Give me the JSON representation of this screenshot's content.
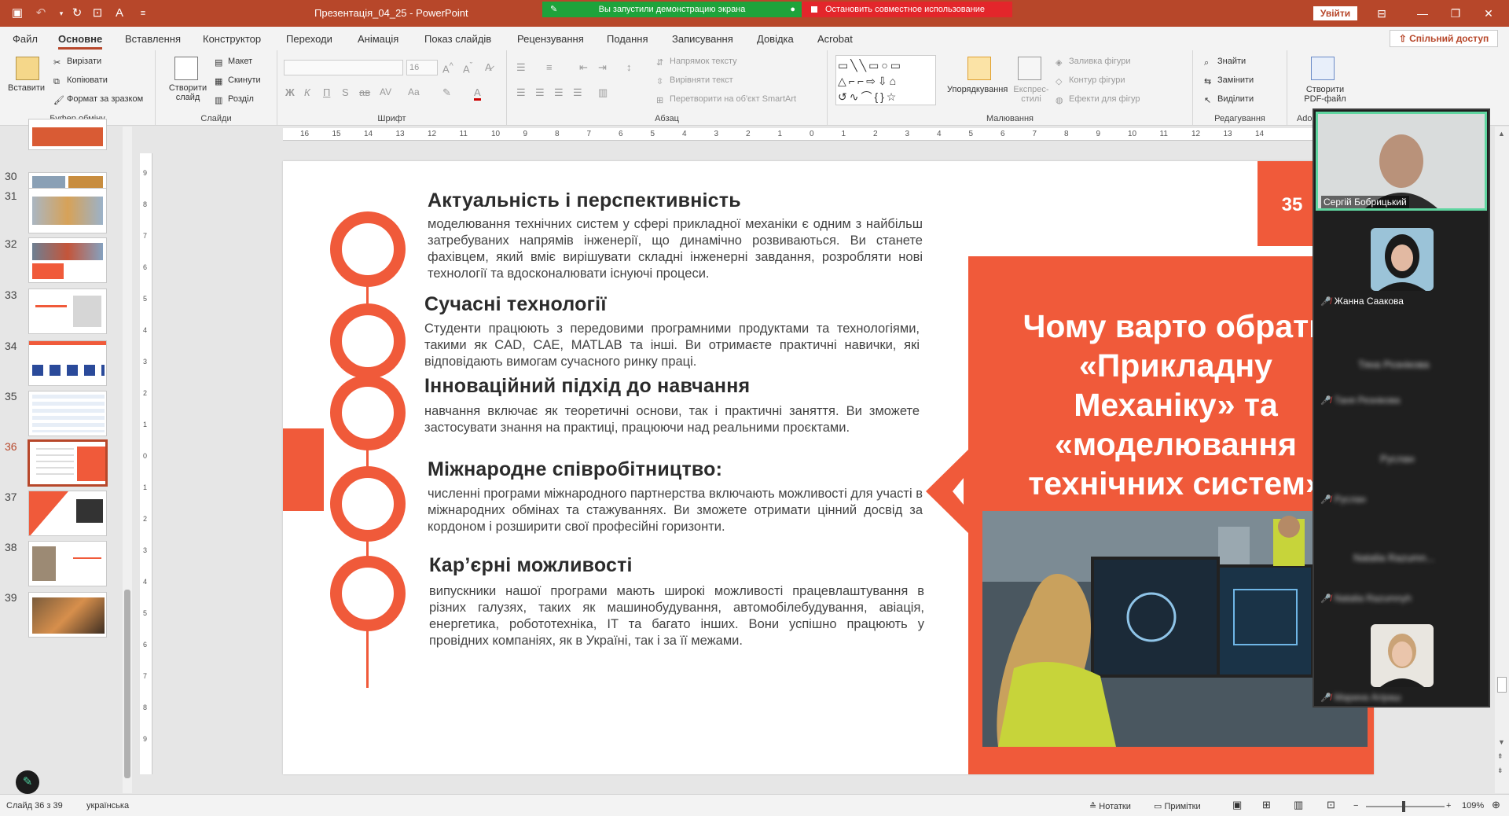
{
  "titlebar": {
    "document_title": "Презентація_04_25  -  PowerPoint",
    "screen_share_notice": "Вы запустили демонстрацию экрана",
    "stop_sharing": "Остановить совместное использование",
    "sign_in": "Увійти"
  },
  "ribbon_tabs": [
    "Файл",
    "Основне",
    "Вставлення",
    "Конструктор",
    "Переходи",
    "Анімація",
    "Показ слайдів",
    "Рецензування",
    "Подання",
    "Записування",
    "Довідка",
    "Acrobat"
  ],
  "share_button": "Спільний доступ",
  "ribbon": {
    "clipboard": {
      "paste": "Вставити",
      "cut": "Вирізати",
      "copy": "Копіювати",
      "format_painter": "Формат за зразком",
      "label": "Буфер обміну"
    },
    "slides": {
      "new_slide": "Створити слайд",
      "layout": "Макет",
      "reset": "Скинути",
      "section": "Розділ",
      "label": "Слайди"
    },
    "font": {
      "size": "16",
      "label": "Шрифт"
    },
    "paragraph": {
      "text_direction": "Напрямок тексту",
      "align_text": "Вирівняти текст",
      "convert_smartart": "Перетворити на об'єкт SmartArt",
      "label": "Абзац"
    },
    "drawing": {
      "arrange": "Упорядкування",
      "quick_styles": "Експрес-стилі",
      "shape_fill": "Заливка фігури",
      "shape_outline": "Контур фігури",
      "shape_effects": "Ефекти для фігур",
      "label": "Малювання"
    },
    "editing": {
      "find": "Знайти",
      "replace": "Замінити",
      "select": "Виділити",
      "label": "Редагування"
    },
    "adobe": {
      "create_pdf": "Створити PDF-файл",
      "label": "Adobe Acrobat"
    }
  },
  "thumbnails": {
    "numbers": [
      "30",
      "31",
      "32",
      "33",
      "34",
      "35",
      "36",
      "37",
      "38",
      "39"
    ],
    "active_index": 6
  },
  "ruler": [
    "16",
    "15",
    "14",
    "13",
    "12",
    "11",
    "10",
    "9",
    "8",
    "7",
    "6",
    "5",
    "4",
    "3",
    "2",
    "1",
    "0",
    "1",
    "2",
    "3",
    "4",
    "5",
    "6",
    "7",
    "8",
    "9",
    "10",
    "11",
    "12",
    "13",
    "14"
  ],
  "slide": {
    "number": "35",
    "panel_title": "Чому варто обрати «Прикладну Механіку» та «моделювання технічних систем»",
    "sections": [
      {
        "heading": "Актуальність і перспективність",
        "body": "моделювання технічних систем у сфері прикладної механіки є одним з найбільш затребуваних напрямів інженерії, що динамічно розвиваються. Ви станете фахівцем, який вміє вирішувати складні інженерні завдання, розробляти нові технології та вдосконалювати існуючі процеси."
      },
      {
        "heading": "Сучасні технології",
        "body": "Студенти працюють з передовими програмними продуктами та технологіями, такими як CAD, CAE, MATLAB та інші. Ви отримаєте практичні навички, які відповідають вимогам сучасного ринку праці."
      },
      {
        "heading": "Інноваційний підхід до навчання",
        "body": "навчання включає як теоретичні основи, так і практичні заняття. Ви зможете застосувати знання на практиці, працюючи над реальними проєктами."
      },
      {
        "heading": "Міжнародне співробітництво:",
        "body": "численні програми міжнародного партнерства включають можливості для участі в міжнародних обмінах та стажуваннях. Ви зможете отримати цінний досвід за кордоном і розширити свої професійні горизонти."
      },
      {
        "heading": "Кар’єрні можливості",
        "body": "випускники нашої програми мають широкі можливості працевлаштування в різних галузях, таких як машинобудування, автомобілебудування, авіація, енергетика, робототехніка, IT та багато інших. Вони успішно працюють у провідних компаніях, як в Україні, так і за її межами."
      }
    ]
  },
  "video_participants": [
    {
      "name": "Сергій Бобрицький",
      "speaking": true
    },
    {
      "name": "Жанна Саакова",
      "muted": true
    },
    {
      "name": "Таня Резнікова",
      "muted": true
    },
    {
      "name": "Руслан",
      "muted": true
    },
    {
      "name": "Natalia Razumnyh",
      "muted": true
    },
    {
      "name": "Марина Агіраш",
      "muted": true
    }
  ],
  "video_center_labels": [
    "Тяна Рознікова",
    "Руслан",
    "Natalia Razumn..."
  ],
  "statusbar": {
    "slide_info": "Слайд 36 з 39",
    "language": "українська",
    "notes": "Нотатки",
    "comments": "Примітки",
    "zoom": "109%"
  },
  "colors": {
    "accent": "#f05a3a",
    "brand": "#b7472a",
    "share_green": "#1ea33b",
    "share_red": "#e3262b"
  }
}
